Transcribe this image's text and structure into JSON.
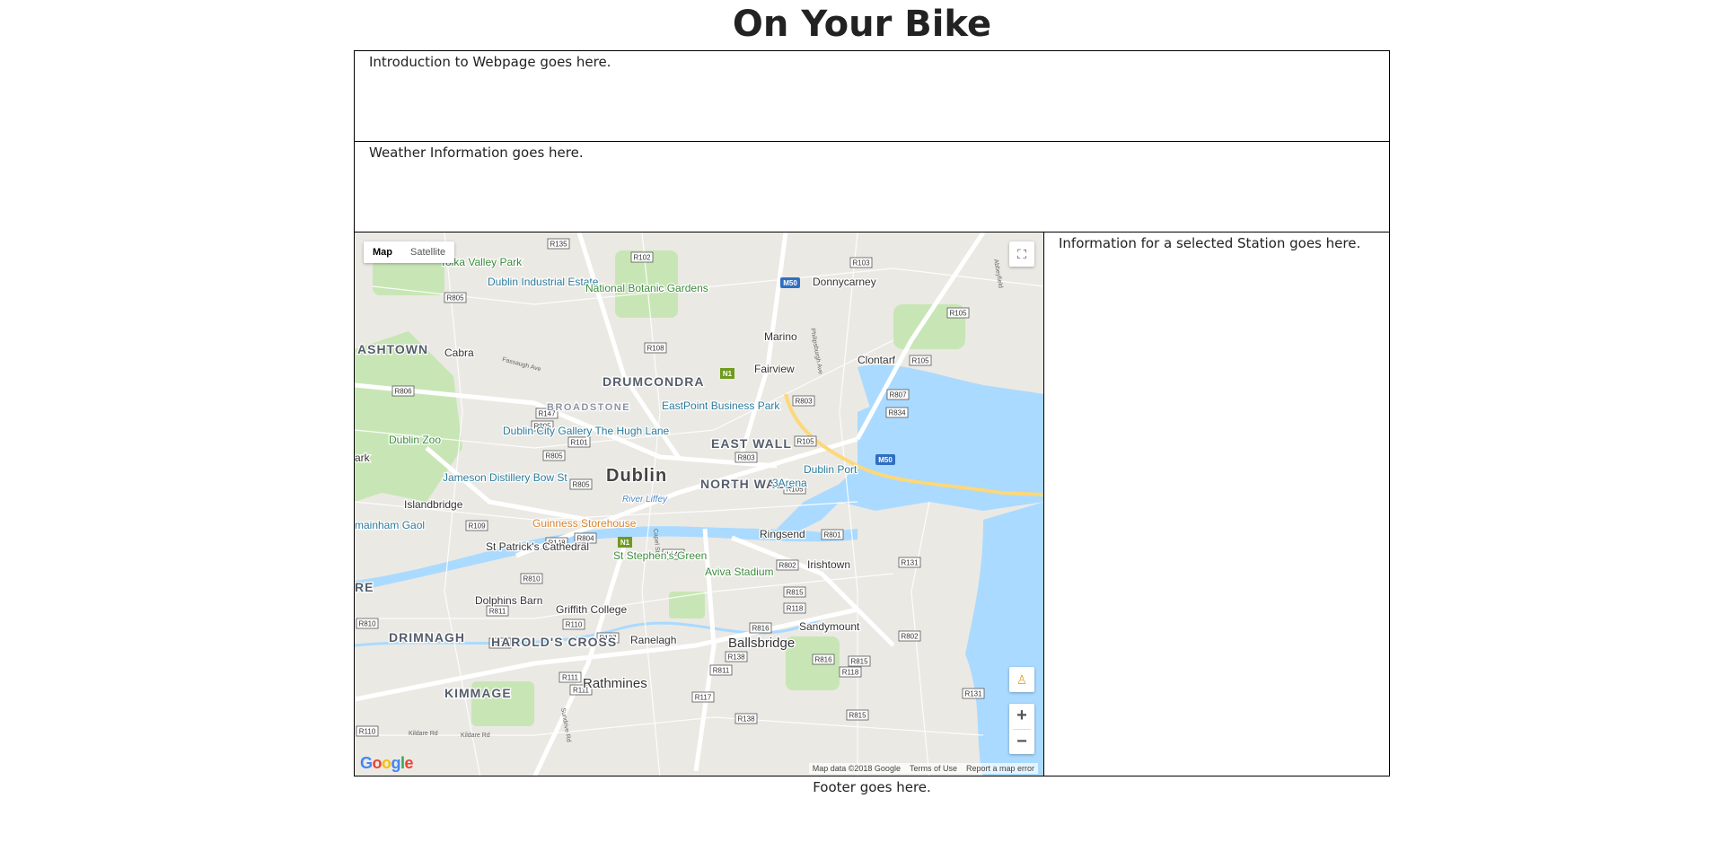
{
  "header": {
    "title": "On Your Bike"
  },
  "intro": {
    "text": "Introduction to Webpage goes here."
  },
  "weather": {
    "text": "Weather Information goes here."
  },
  "station": {
    "text": "Information for a selected Station goes here."
  },
  "footer": {
    "text": "Footer goes here."
  },
  "map": {
    "type_control": {
      "map_label": "Map",
      "satellite_label": "Satellite",
      "selected": "Map"
    },
    "attribution": {
      "data": "Map data ©2018 Google",
      "terms": "Terms of Use",
      "report": "Report a map error"
    },
    "logo_text": "Google",
    "logo_colors": [
      "#4285f4",
      "#ea4335",
      "#fbbc05",
      "#4285f4",
      "#34a853",
      "#ea4335"
    ],
    "colors": {
      "water": "#aadaff",
      "park": "#c8e6b5",
      "land": "#ebe9e4",
      "road": "#ffffff",
      "motorway": "#fdd87a"
    },
    "labels": [
      {
        "text": "Tolka Valley Park",
        "kind": "park"
      },
      {
        "text": "Dublin Industrial Estate",
        "kind": "poi"
      },
      {
        "text": "National Botanic Gardens",
        "kind": "park"
      },
      {
        "text": "Donnycarney",
        "kind": "place"
      },
      {
        "text": "Marino",
        "kind": "place"
      },
      {
        "text": "ASHTOWN",
        "kind": "district"
      },
      {
        "text": "Cabra",
        "kind": "place"
      },
      {
        "text": "Fairview",
        "kind": "place"
      },
      {
        "text": "Clontarf",
        "kind": "place"
      },
      {
        "text": "DRUMCONDRA",
        "kind": "district"
      },
      {
        "text": "BROADSTONE",
        "kind": "district-light"
      },
      {
        "text": "EastPoint Business Park",
        "kind": "poi"
      },
      {
        "text": "Dublin Zoo",
        "kind": "park"
      },
      {
        "text": "Dublin City Gallery The Hugh Lane",
        "kind": "poi"
      },
      {
        "text": "EAST WALL",
        "kind": "district"
      },
      {
        "text": "Dublin Port",
        "kind": "poi"
      },
      {
        "text": "Jameson Distillery Bow St",
        "kind": "poi"
      },
      {
        "text": "Dublin",
        "kind": "city"
      },
      {
        "text": "NORTH WALL",
        "kind": "district"
      },
      {
        "text": "3Arena",
        "kind": "poi"
      },
      {
        "text": "Islandbridge",
        "kind": "place"
      },
      {
        "text": "River Liffey",
        "kind": "water"
      },
      {
        "text": "Guinness Storehouse",
        "kind": "poi-orange"
      },
      {
        "text": "Ringsend",
        "kind": "place"
      },
      {
        "text": "St Patrick's Cathedral",
        "kind": "place"
      },
      {
        "text": "St Stephen's Green",
        "kind": "park"
      },
      {
        "text": "Irishtown",
        "kind": "place"
      },
      {
        "text": "Aviva Stadium",
        "kind": "park"
      },
      {
        "text": "Dolphins Barn",
        "kind": "place"
      },
      {
        "text": "Griffith College",
        "kind": "place"
      },
      {
        "text": "Sandymount",
        "kind": "place"
      },
      {
        "text": "DRIMNAGH",
        "kind": "district"
      },
      {
        "text": "HAROLD'S CROSS",
        "kind": "district"
      },
      {
        "text": "Ranelagh",
        "kind": "place"
      },
      {
        "text": "Ballsbridge",
        "kind": "place-big"
      },
      {
        "text": "Rathmines",
        "kind": "place-big"
      },
      {
        "text": "KIMMAGE",
        "kind": "district"
      },
      {
        "text": "mainham Gaol",
        "kind": "poi"
      },
      {
        "text": "ark",
        "kind": "place"
      },
      {
        "text": "RE",
        "kind": "district"
      }
    ],
    "road_shields": [
      "R135",
      "R102",
      "R103",
      "R805",
      "R108",
      "R806",
      "R147",
      "R805",
      "R101",
      "R805",
      "R805",
      "R109",
      "R148",
      "R804",
      "R148",
      "R810",
      "R811",
      "R810",
      "R111",
      "R110",
      "R137",
      "R138",
      "R111",
      "R111",
      "R811",
      "R117",
      "R138",
      "R105",
      "R807",
      "R834",
      "R803",
      "R105",
      "R803",
      "R105",
      "R801",
      "R802",
      "R815",
      "R118",
      "R816",
      "R816",
      "R815",
      "R118",
      "R131",
      "R802",
      "R131",
      "R815",
      "R105",
      "R110"
    ],
    "motorway_shields": [
      "M50",
      "M50"
    ],
    "national_shields": [
      "N1",
      "N1"
    ],
    "street_labels": [
      "Fassaugh Ave",
      "Abbeyfield",
      "Philipsburgh Ave",
      "Capel St",
      "Sundrive Rd",
      "Kildare Rd",
      "Kildare Rd"
    ]
  }
}
